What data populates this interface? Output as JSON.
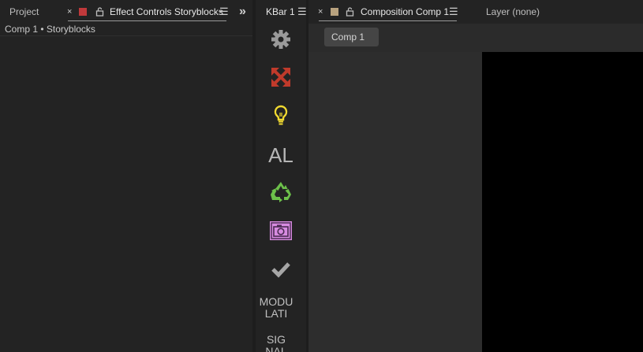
{
  "left_panel": {
    "tab_project": "Project",
    "tab_effect_controls": "Effect Controls Storyblocks",
    "close_glyph": "×",
    "menu_glyph": "☰",
    "overflow_glyph": "»",
    "subtitle": "Comp 1 • Storyblocks",
    "swatch_color": "#c0393b"
  },
  "kbar": {
    "title": "KBar 1",
    "menu_glyph": "☰",
    "buttons": [
      {
        "icon": "gear-icon",
        "color": "#9a9a9a"
      },
      {
        "icon": "expand-arrows-icon",
        "color": "#c03a2b"
      },
      {
        "icon": "lightbulb-icon",
        "color": "#f0d930"
      },
      {
        "icon": "al-text-icon",
        "text": "AL"
      },
      {
        "icon": "recycle-icon",
        "color": "#6cc04a"
      },
      {
        "icon": "camera-icon",
        "color": "#d78be0"
      },
      {
        "icon": "checkmark-icon",
        "color": "#a6a6a6"
      }
    ],
    "text_buttons": [
      {
        "line1": "MODU",
        "line2": "LATI"
      },
      {
        "line1": "SIG",
        "line2": "NAL"
      }
    ]
  },
  "comp_panel": {
    "close_glyph": "×",
    "tab_composition": "Composition Comp 1",
    "menu_glyph": "☰",
    "tab_layer": "Layer (none)",
    "comp_button": "Comp 1",
    "swatch_color": "#b8a27e"
  }
}
